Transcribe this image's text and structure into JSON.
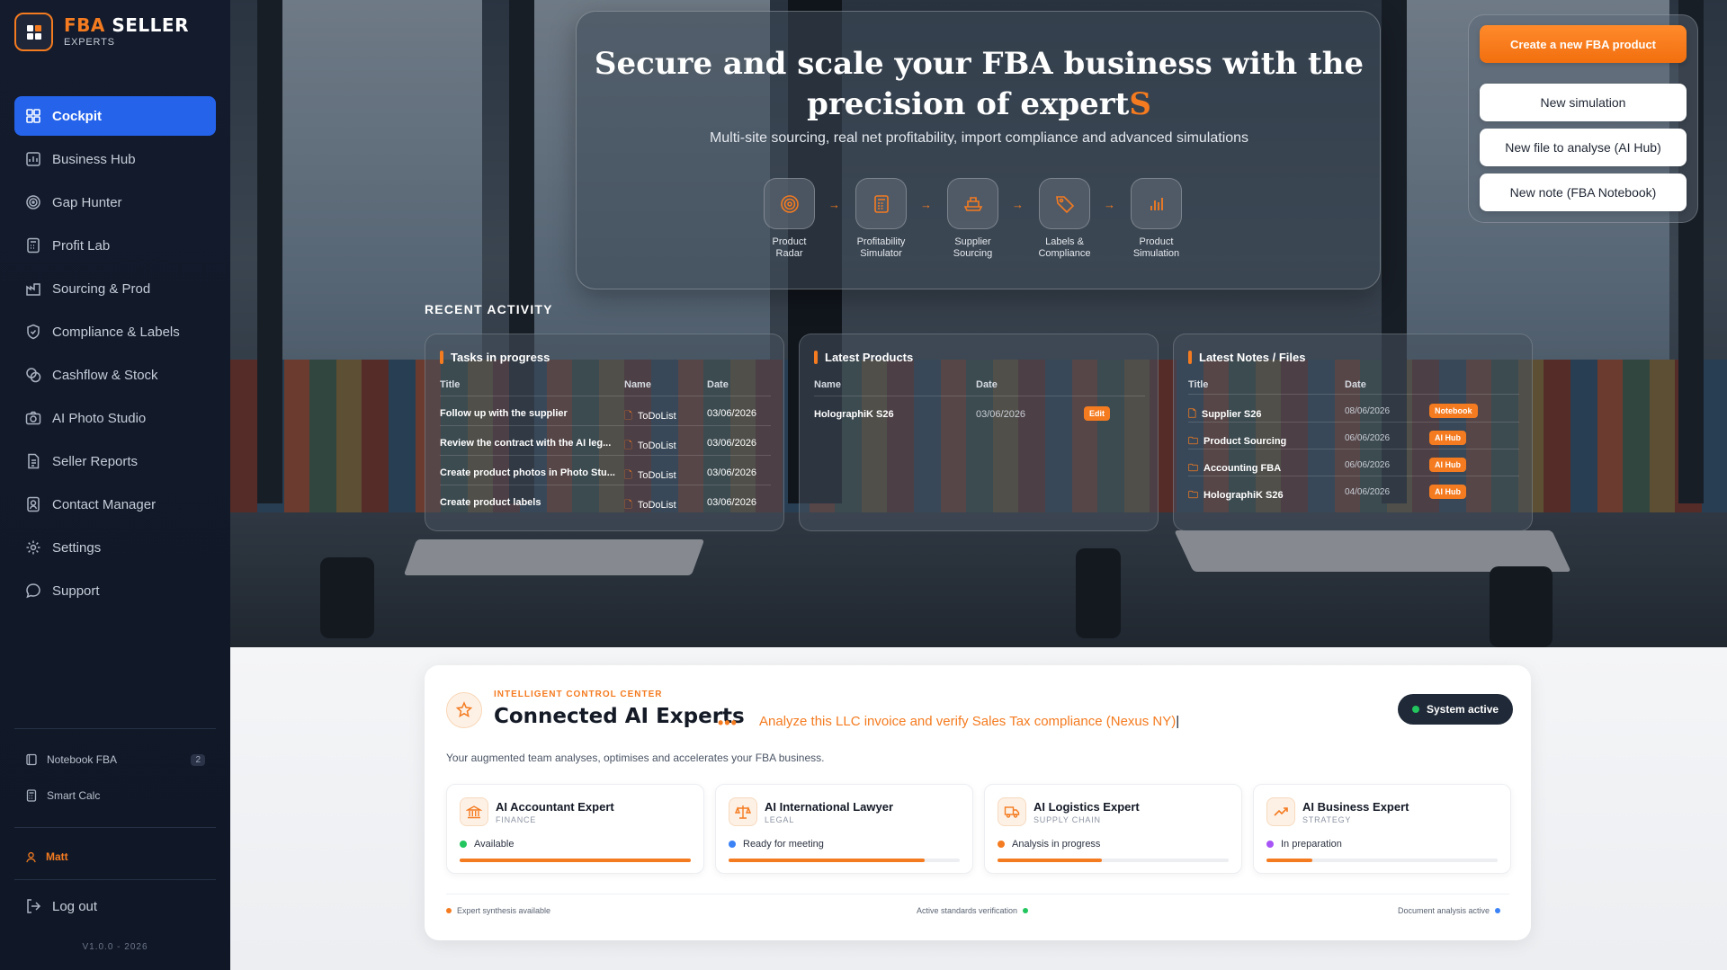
{
  "brand": {
    "name_a": "FBA",
    "name_b": " SELLER",
    "sub": "EXPERTS",
    "accent": "#f47b20",
    "nav_active_color": "#2563eb"
  },
  "sidebar": {
    "items": [
      {
        "label": "Cockpit",
        "icon": "dashboard-icon"
      },
      {
        "label": "Business Hub",
        "icon": "chart-icon"
      },
      {
        "label": "Gap Hunter",
        "icon": "target-icon"
      },
      {
        "label": "Profit Lab",
        "icon": "calculator-icon"
      },
      {
        "label": "Sourcing & Prod",
        "icon": "factory-icon"
      },
      {
        "label": "Compliance & Labels",
        "icon": "shield-check-icon"
      },
      {
        "label": "Cashflow & Stock",
        "icon": "coins-icon"
      },
      {
        "label": "AI Photo Studio",
        "icon": "camera-icon"
      },
      {
        "label": "Seller Reports",
        "icon": "document-icon"
      },
      {
        "label": "Contact Manager",
        "icon": "contact-book-icon"
      },
      {
        "label": "Settings",
        "icon": "gear-icon"
      },
      {
        "label": "Support",
        "icon": "chat-bubble-icon"
      }
    ],
    "notebook": {
      "label": "Notebook FBA",
      "count": "2"
    },
    "smartcalc": {
      "label": "Smart Calc"
    },
    "user": "Matt",
    "logout": "Log out",
    "version": "V1.0.0 - 2026"
  },
  "hero": {
    "title_line1": "Secure and scale your FBA business with the",
    "title_line2": "precision of expert",
    "title_accent": "S",
    "subtitle": "Multi-site sourcing, real net profitability, import compliance and advanced simulations",
    "tools": [
      {
        "l1": "Product",
        "l2": "Radar",
        "icon": "radar-icon"
      },
      {
        "l1": "Profitability",
        "l2": "Simulator",
        "icon": "calculator-icon"
      },
      {
        "l1": "Supplier",
        "l2": "Sourcing",
        "icon": "ship-icon"
      },
      {
        "l1": "Labels &",
        "l2": "Compliance",
        "icon": "tag-icon"
      },
      {
        "l1": "Product",
        "l2": "Simulation",
        "icon": "bar-chart-icon"
      }
    ]
  },
  "quick_actions": {
    "create": "Create a new FBA product",
    "simulation": "New simulation",
    "file": "New file to analyse (AI Hub)",
    "note": "New note (FBA Notebook)"
  },
  "recent": {
    "title": "RECENT ACTIVITY",
    "tasks": {
      "title": "Tasks in progress",
      "headers": [
        "Title",
        "Name",
        "Date"
      ],
      "rows": [
        {
          "title": "Follow up with the supplier",
          "name": "ToDoList",
          "date": "03/06/2026"
        },
        {
          "title": "Review the contract with the AI leg...",
          "name": "ToDoList",
          "date": "03/06/2026"
        },
        {
          "title": "Create product photos in Photo Stu...",
          "name": "ToDoList",
          "date": "03/06/2026"
        },
        {
          "title": "Create product labels",
          "name": "ToDoList",
          "date": "03/06/2026"
        }
      ]
    },
    "products": {
      "title": "Latest Products",
      "headers": [
        "Name",
        "Date"
      ],
      "rows": [
        {
          "name": "HolographiK S26",
          "date": "03/06/2026",
          "action": "Edit"
        }
      ]
    },
    "notes": {
      "title": "Latest Notes / Files",
      "headers": [
        "Title",
        "Date"
      ],
      "rows": [
        {
          "title": "Supplier S26",
          "date": "08/06/2026",
          "tag": "Notebook"
        },
        {
          "title": "Product Sourcing",
          "date": "06/06/2026",
          "tag": "AI Hub"
        },
        {
          "title": "Accounting FBA",
          "date": "06/06/2026",
          "tag": "AI Hub"
        },
        {
          "title": "HolographiK S26",
          "date": "04/06/2026",
          "tag": "AI Hub"
        }
      ]
    }
  },
  "ai": {
    "kicker": "INTELLIGENT CONTROL CENTER",
    "title": "Connected AI Experts",
    "dots": "•••",
    "typing": "Analyze this LLC invoice and verify Sales Tax compliance (Nexus NY)",
    "status": "System active",
    "description": "Your augmented team analyses, optimises and accelerates your FBA business.",
    "experts": [
      {
        "name": "AI Accountant Expert",
        "role": "FINANCE",
        "status": "Available",
        "status_color": "#22c55e",
        "progress": 1.0,
        "icon": "bank-icon"
      },
      {
        "name": "AI International Lawyer",
        "role": "LEGAL",
        "status": "Ready for meeting",
        "status_color": "#3b82f6",
        "progress": 0.85,
        "icon": "scales-icon"
      },
      {
        "name": "AI Logistics Expert",
        "role": "SUPPLY CHAIN",
        "status": "Analysis in progress",
        "status_color": "#f47b20",
        "progress": 0.45,
        "icon": "truck-icon"
      },
      {
        "name": "AI Business Expert",
        "role": "STRATEGY",
        "status": "In preparation",
        "status_color": "#a855f7",
        "progress": 0.2,
        "icon": "trend-icon"
      }
    ],
    "footer": [
      {
        "text": "Expert synthesis available",
        "color": "#f47b20"
      },
      {
        "text": "Active standards verification",
        "color": "#22c55e"
      },
      {
        "text": "Document analysis active",
        "color": "#3b82f6"
      }
    ]
  }
}
